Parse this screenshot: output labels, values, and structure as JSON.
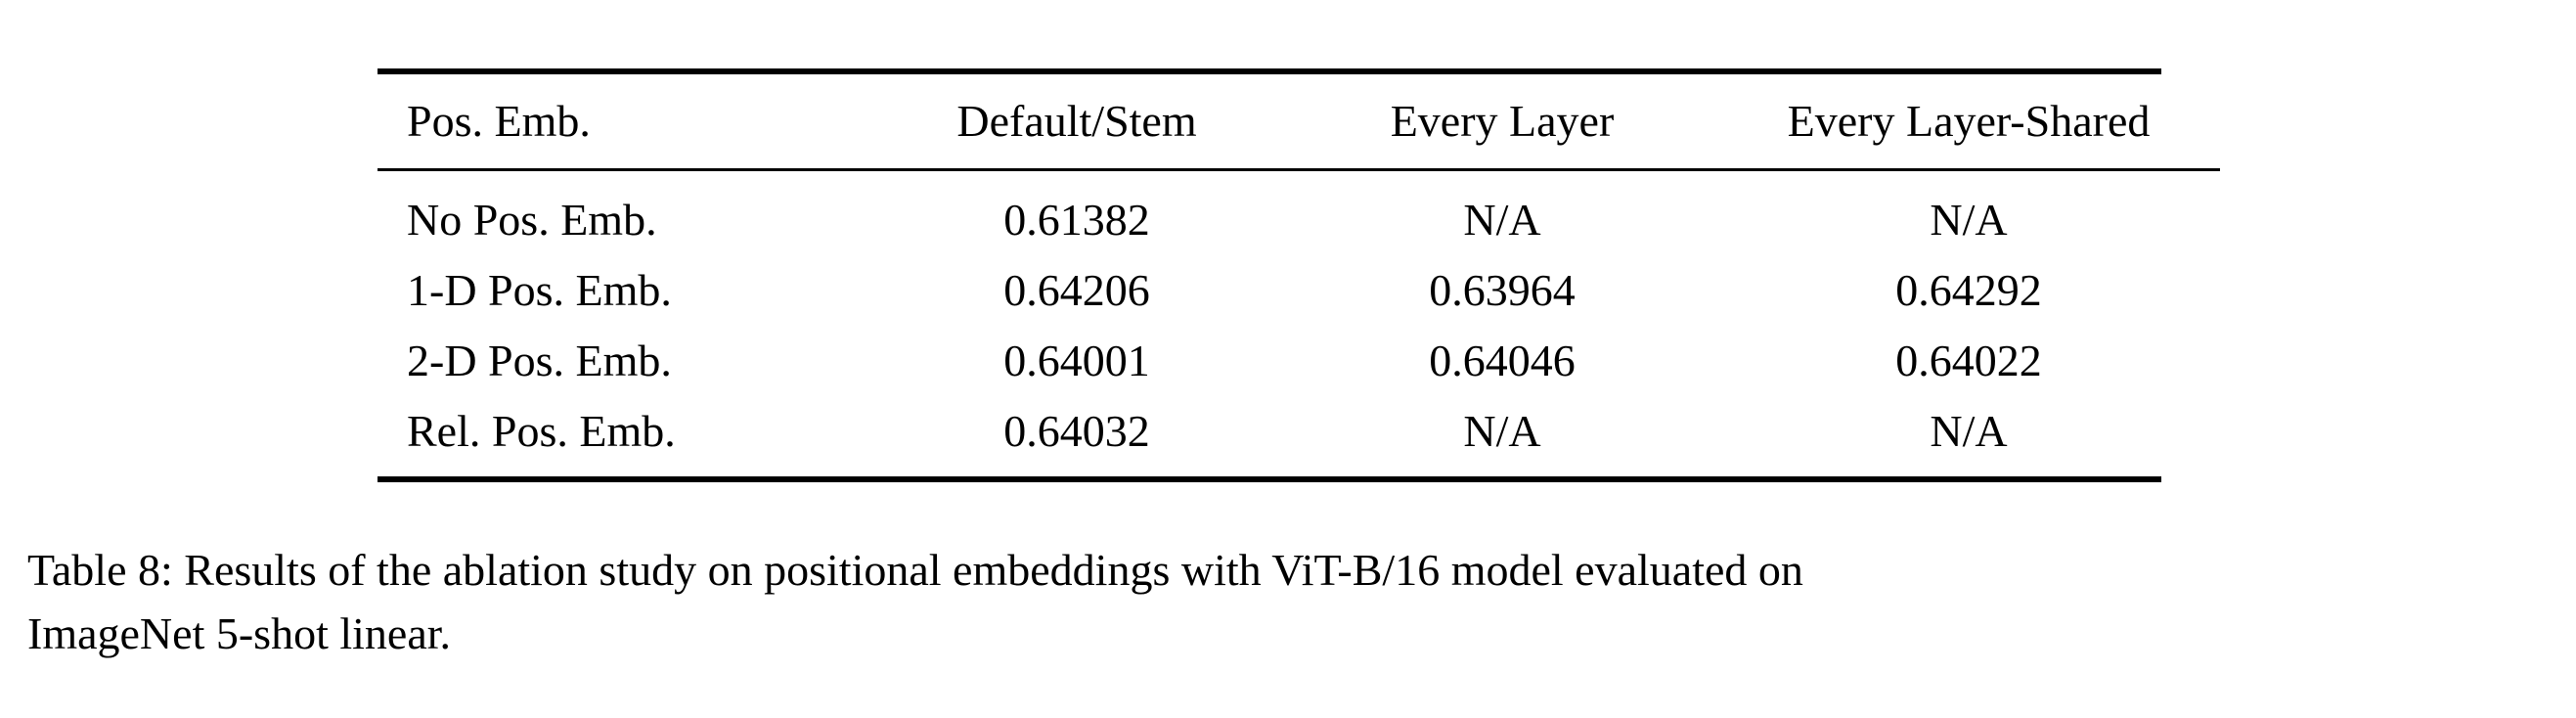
{
  "document": {
    "type": "paper-table-figure",
    "background_color": "#ffffff",
    "text_color": "#000000"
  },
  "table": {
    "id": "table-8",
    "columns": [
      {
        "key": "pos_emb",
        "header": "Pos. Emb.",
        "align": "left"
      },
      {
        "key": "default_stem",
        "header": "Default/Stem",
        "align": "center"
      },
      {
        "key": "every_layer",
        "header": "Every Layer",
        "align": "center"
      },
      {
        "key": "every_layer_shared",
        "header": "Every Layer-Shared",
        "align": "center"
      }
    ],
    "rows": [
      {
        "pos_emb": "No Pos. Emb.",
        "default_stem": "0.61382",
        "every_layer": "N/A",
        "every_layer_shared": "N/A"
      },
      {
        "pos_emb": "1-D Pos. Emb.",
        "default_stem": "0.64206",
        "every_layer": "0.63964",
        "every_layer_shared": "0.64292"
      },
      {
        "pos_emb": "2-D Pos. Emb.",
        "default_stem": "0.64001",
        "every_layer": "0.64046",
        "every_layer_shared": "0.64022"
      },
      {
        "pos_emb": "Rel. Pos. Emb.",
        "default_stem": "0.64032",
        "every_layer": "N/A",
        "every_layer_shared": "N/A"
      }
    ]
  },
  "caption": {
    "full_text": "Table 8: Results of the ablation study on positional embeddings with ViT-B/16 model evaluated on ImageNet 5-shot linear.",
    "line_1": "Table 8: Results of the ablation study on positional embeddings with ViT-B/16 model evaluated on",
    "line_2": "ImageNet 5-shot linear."
  }
}
